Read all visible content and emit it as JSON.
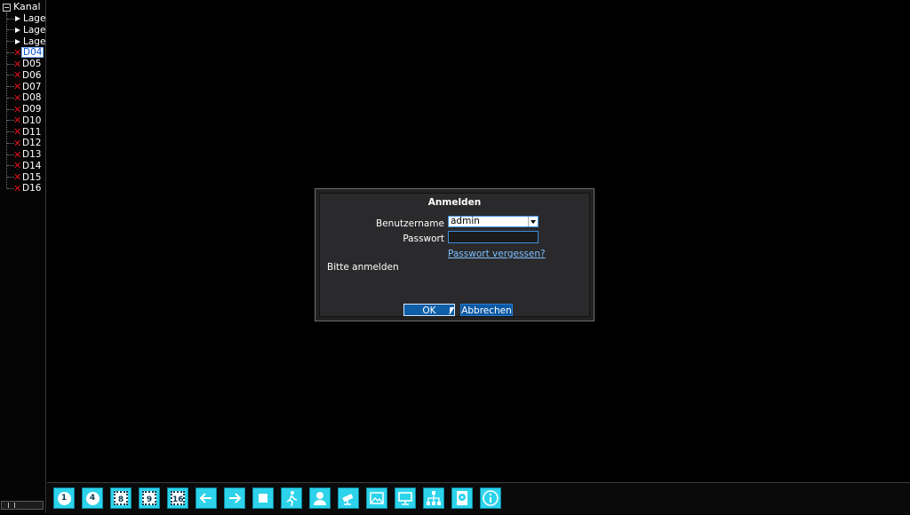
{
  "sidebar": {
    "root_label": "Kanal",
    "items": [
      {
        "label": "Lage",
        "type": "group"
      },
      {
        "label": "Lage",
        "type": "group"
      },
      {
        "label": "Lage",
        "type": "group"
      },
      {
        "label": "D04",
        "type": "channel",
        "selected": true
      },
      {
        "label": "D05",
        "type": "channel"
      },
      {
        "label": "D06",
        "type": "channel"
      },
      {
        "label": "D07",
        "type": "channel"
      },
      {
        "label": "D08",
        "type": "channel"
      },
      {
        "label": "D09",
        "type": "channel"
      },
      {
        "label": "D10",
        "type": "channel"
      },
      {
        "label": "D11",
        "type": "channel"
      },
      {
        "label": "D12",
        "type": "channel"
      },
      {
        "label": "D13",
        "type": "channel"
      },
      {
        "label": "D14",
        "type": "channel"
      },
      {
        "label": "D15",
        "type": "channel"
      },
      {
        "label": "D16",
        "type": "channel"
      }
    ]
  },
  "login": {
    "title": "Anmelden",
    "username_label": "Benutzername",
    "username_value": "admin",
    "password_label": "Passwort",
    "password_value": "",
    "forgot_link": "Passwort vergessen?",
    "status": "Bitte anmelden",
    "ok_label": "OK",
    "cancel_label": "Abbrechen"
  },
  "toolbar": {
    "buttons": [
      {
        "icon": "layout-1-icon",
        "text": "1"
      },
      {
        "icon": "layout-4-icon",
        "text": "4"
      },
      {
        "icon": "layout-8-icon",
        "text": "8"
      },
      {
        "icon": "layout-9-icon",
        "text": "9"
      },
      {
        "icon": "layout-16-icon",
        "text": "16"
      },
      {
        "icon": "previous-arrow-icon"
      },
      {
        "icon": "next-arrow-icon"
      },
      {
        "icon": "stop-icon"
      },
      {
        "icon": "person-walking-icon"
      },
      {
        "icon": "user-icon"
      },
      {
        "icon": "ptz-camera-icon"
      },
      {
        "icon": "picture-icon"
      },
      {
        "icon": "monitor-icon"
      },
      {
        "icon": "network-icon"
      },
      {
        "icon": "hard-disk-icon"
      },
      {
        "icon": "info-icon"
      }
    ]
  },
  "colors": {
    "accent": "#2cd3ea",
    "button_blue": "#0f5fa8",
    "error_red": "#e0101a",
    "link": "#7ec0ff"
  }
}
